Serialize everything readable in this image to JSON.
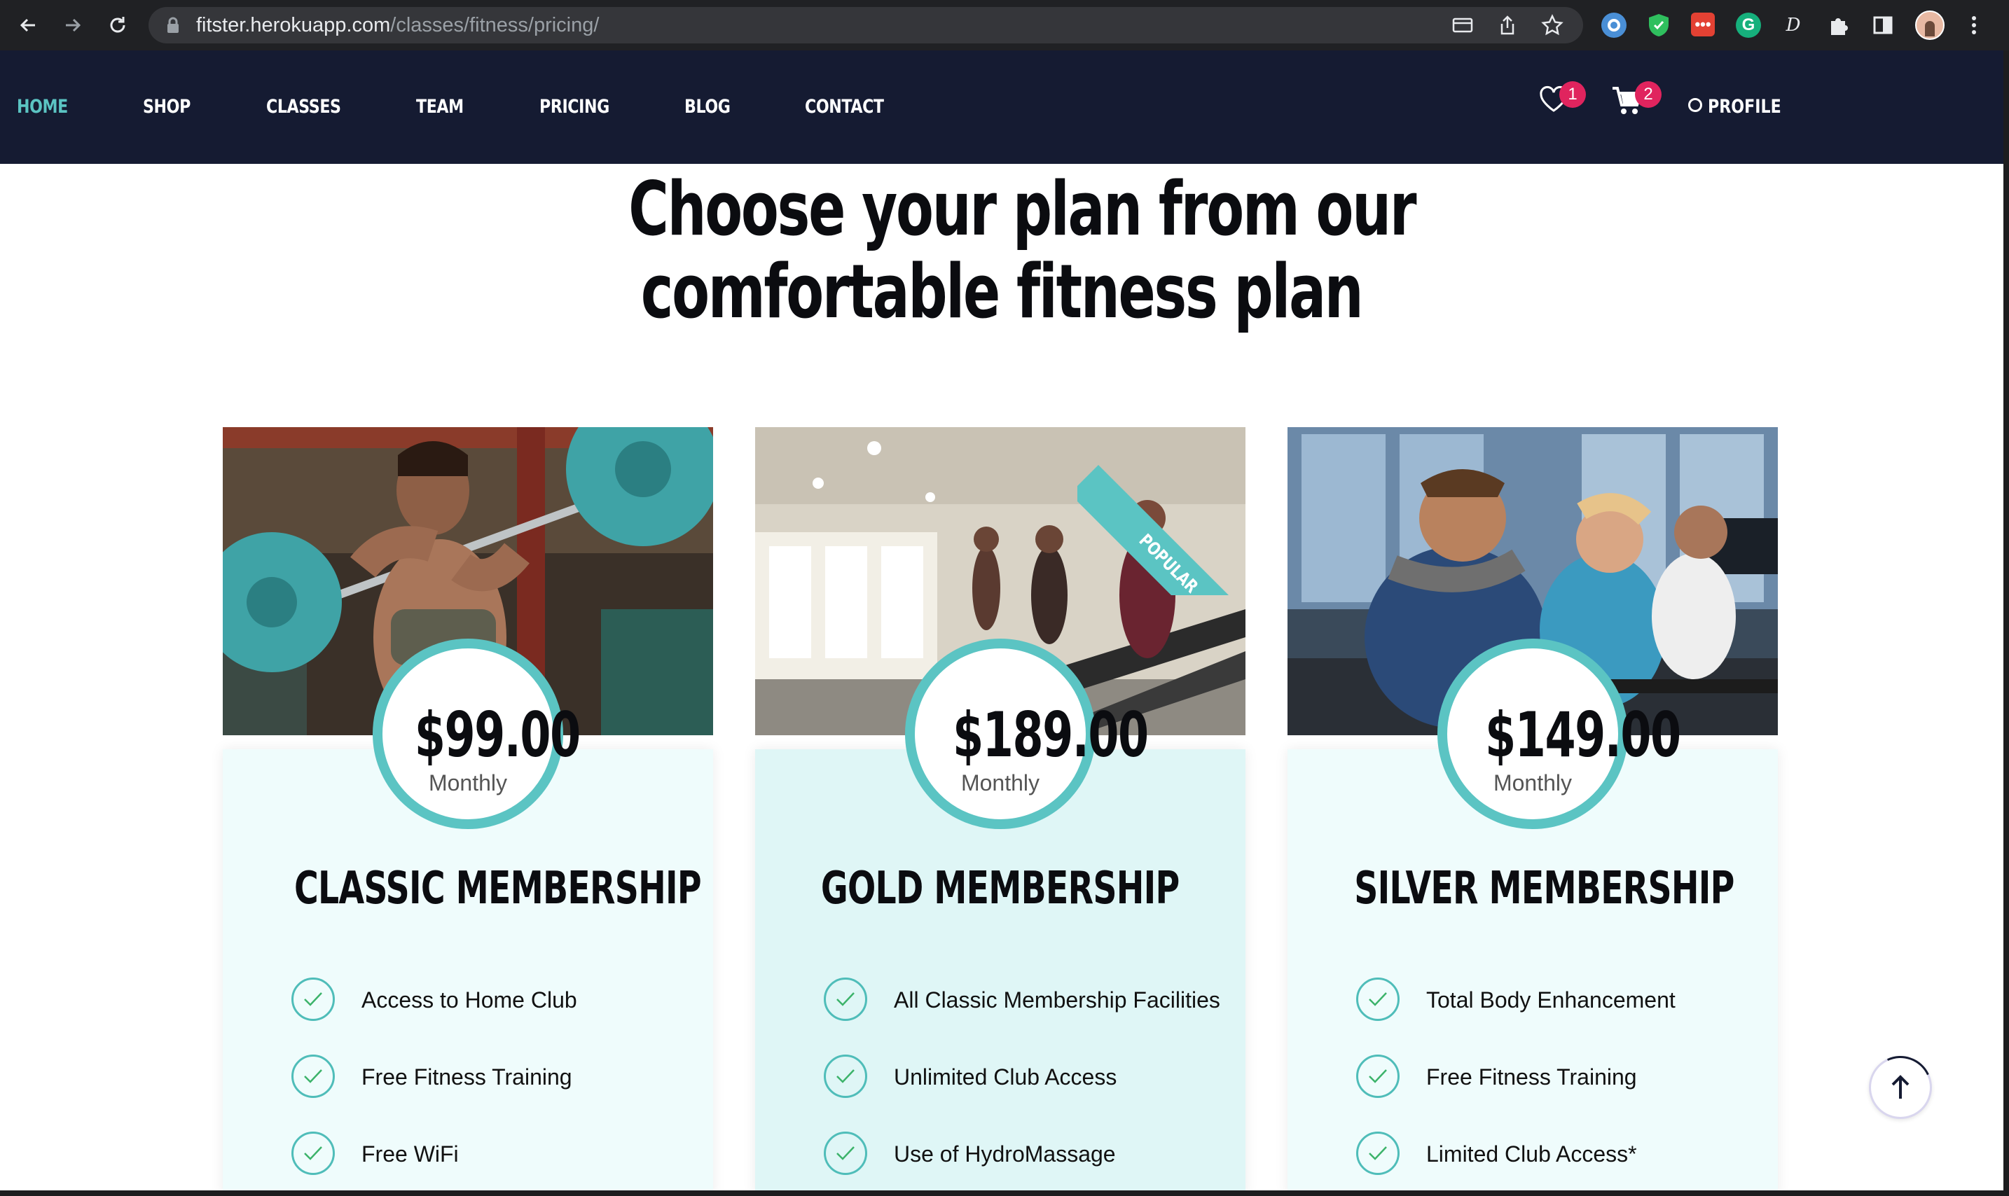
{
  "browser": {
    "url_host": "fitster.herokuapp.com",
    "url_path": "/classes/fitness/pricing/"
  },
  "nav": {
    "items": [
      {
        "label": "HOME",
        "active": true
      },
      {
        "label": "SHOP",
        "active": false
      },
      {
        "label": "CLASSES",
        "active": false
      },
      {
        "label": "TEAM",
        "active": false
      },
      {
        "label": "PRICING",
        "active": false
      },
      {
        "label": "BLOG",
        "active": false
      },
      {
        "label": "CONTACT",
        "active": false
      }
    ],
    "wishlist_count": "1",
    "cart_count": "2",
    "profile_label": "PROFILE"
  },
  "heading": {
    "line1": "Choose your plan from our",
    "line2": "comfortable fitness plan"
  },
  "plans": [
    {
      "price": "$99.00",
      "period": "Monthly",
      "title": "CLASSIC MEMBERSHIP",
      "features": [
        "Access to Home Club",
        "Free Fitness Training",
        "Free WiFi"
      ],
      "image": "woman-lifting-barbell"
    },
    {
      "price": "$189.00",
      "period": "Monthly",
      "title": "GOLD MEMBERSHIP",
      "ribbon": "POPULAR",
      "features": [
        "All Classic Membership Facilities",
        "Unlimited Club Access",
        "Use of HydroMassage"
      ],
      "image": "people-on-treadmills"
    },
    {
      "price": "$149.00",
      "period": "Monthly",
      "title": "SILVER MEMBERSHIP",
      "features": [
        "Total Body Enhancement",
        "Free Fitness Training",
        "Limited Club Access*"
      ],
      "image": "people-on-spin-bikes"
    }
  ],
  "colors": {
    "header_bg": "#151b32",
    "accent": "#5bc4c3",
    "badge": "#e0245e"
  }
}
